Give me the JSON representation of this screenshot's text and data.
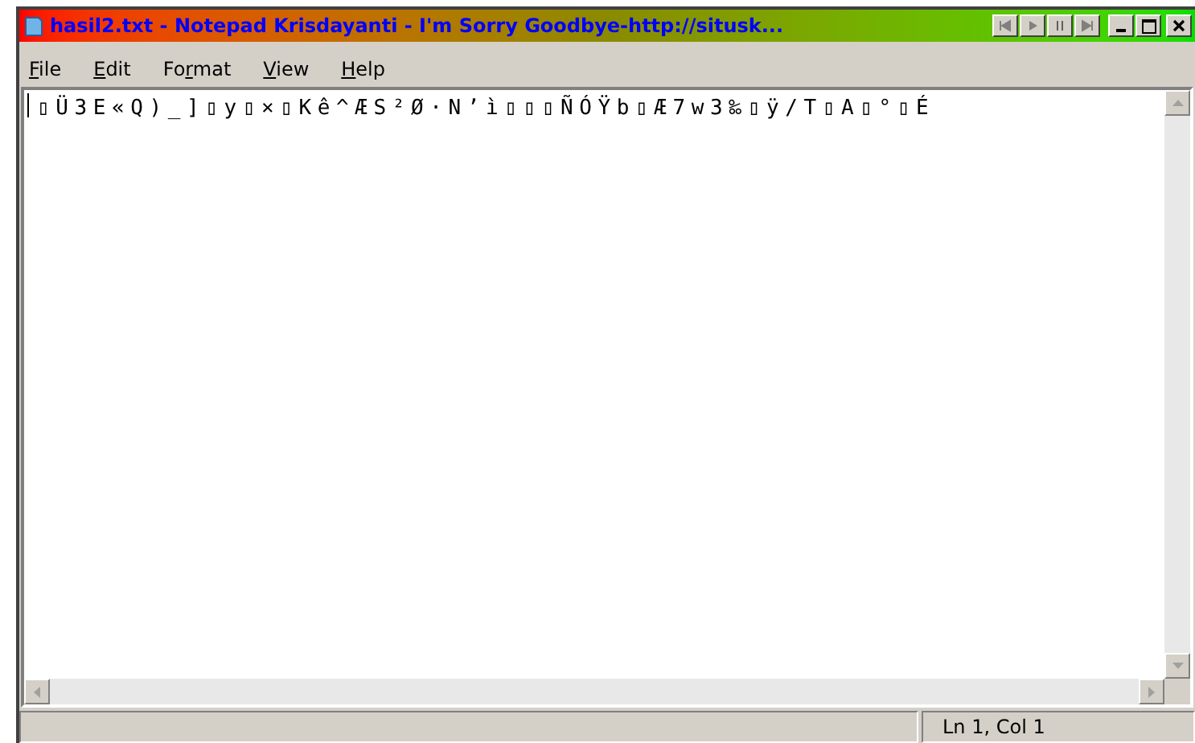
{
  "window": {
    "title": "hasil2.txt - Notepad Krisdayanti - I'm Sorry Goodbye-http://situsk..."
  },
  "menu": [
    {
      "label": "F",
      "rest": "ile"
    },
    {
      "label": "E",
      "rest": "dit"
    },
    {
      "label": "Fo",
      "u": "r",
      "rest": "mat"
    },
    {
      "label": "V",
      "rest": "iew"
    },
    {
      "label": "H",
      "rest": "elp"
    }
  ],
  "editor": {
    "text": "▯Ü3E«Q)_]▯y▯×▯Kê^ÆS²Ø·N’ì▯▯▯ÑÓŸb▯Æ7w3‰▯ÿ/T▯A▯°▯É"
  },
  "status_bar": {
    "position": "Ln 1, Col 1"
  }
}
